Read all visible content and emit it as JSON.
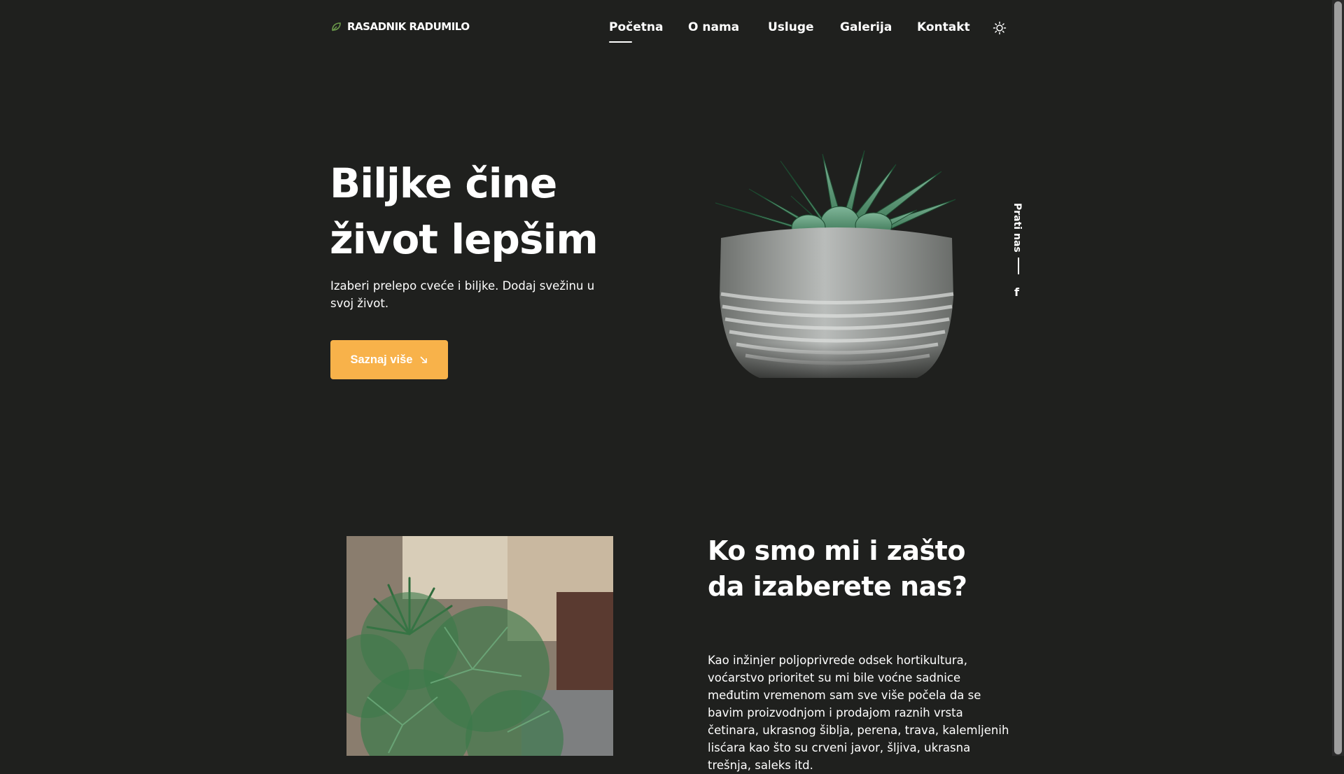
{
  "brand": {
    "name": "RASADNIK RADUMILO",
    "icon": "leaf-icon",
    "icon_color": "#6b9a4a"
  },
  "nav": {
    "items": [
      {
        "label": "Početna",
        "active": true
      },
      {
        "label": "O nama"
      },
      {
        "label": "Usluge"
      },
      {
        "label": "Galerija"
      },
      {
        "label": "Kontakt"
      }
    ],
    "theme_toggle_icon": "sun-icon"
  },
  "hero": {
    "title": "Biljke čine život lepšim",
    "subtitle": "Izaberi prelepo cveće i biljke. Dodaj svežinu u svoj život.",
    "cta_label": "Saznaj više",
    "cta_icon": "arrow-down-right-icon",
    "cta_color": "#f8b24a"
  },
  "social": {
    "label": "Prati nas",
    "icons": [
      "facebook-icon"
    ]
  },
  "about": {
    "title": "Ko smo mi i zašto da izaberete nas?",
    "text": "Kao inžinjer poljoprivrede odsek hortikultura, voćarstvo prioritet su mi bile voćne sadnice međutim vremenom sam sve više počela da se bavim proizvodnjom i prodajom raznih vrsta četinara, ukrasnog šiblja, perena, trava, kalemljenih lisćara kao što su crveni javor, šljiva, ukrasna trešnja, saleks itd."
  },
  "colors": {
    "background": "#1f201e",
    "accent": "#f8b24a",
    "text": "#ffffff"
  }
}
